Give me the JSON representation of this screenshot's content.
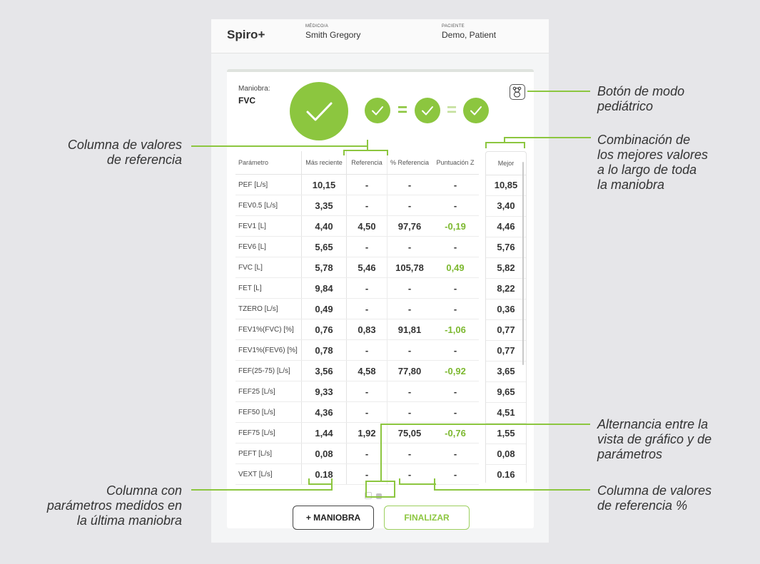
{
  "header": {
    "brand": "Spiro+",
    "doctor_label": "MÉDICO/A",
    "doctor_name": "Smith Gregory",
    "patient_label": "PACIENTE",
    "patient_name": "Demo, Patient"
  },
  "maneuver": {
    "label": "Maniobra:",
    "value": "FVC",
    "eq_sign": "="
  },
  "table": {
    "headers": [
      "Parámetro",
      "Más reciente",
      "Referencia",
      "% Referencia",
      "Puntuación Z"
    ],
    "best_header": "Mejor",
    "rows": [
      {
        "param": "PEF [L/s]",
        "recent": "10,15",
        "ref": "-",
        "pct": "-",
        "z": "-",
        "best": "10,85"
      },
      {
        "param": "FEV0.5 [L/s]",
        "recent": "3,35",
        "ref": "-",
        "pct": "-",
        "z": "-",
        "best": "3,40"
      },
      {
        "param": "FEV1 [L]",
        "recent": "4,40",
        "ref": "4,50",
        "pct": "97,76",
        "z": "-0,19",
        "best": "4,46"
      },
      {
        "param": "FEV6 [L]",
        "recent": "5,65",
        "ref": "-",
        "pct": "-",
        "z": "-",
        "best": "5,76"
      },
      {
        "param": "FVC [L]",
        "recent": "5,78",
        "ref": "5,46",
        "pct": "105,78",
        "z": "0,49",
        "best": "5,82"
      },
      {
        "param": "FET [L]",
        "recent": "9,84",
        "ref": "-",
        "pct": "-",
        "z": "-",
        "best": "8,22"
      },
      {
        "param": "TZERO [L/s]",
        "recent": "0,49",
        "ref": "-",
        "pct": "-",
        "z": "-",
        "best": "0,36"
      },
      {
        "param": "FEV1%(FVC) [%]",
        "recent": "0,76",
        "ref": "0,83",
        "pct": "91,81",
        "z": "-1,06",
        "best": "0,77"
      },
      {
        "param": "FEV1%(FEV6) [%]",
        "recent": "0,78",
        "ref": "-",
        "pct": "-",
        "z": "-",
        "best": "0,77"
      },
      {
        "param": "FEF(25-75) [L/s]",
        "recent": "3,56",
        "ref": "4,58",
        "pct": "77,80",
        "z": "-0,92",
        "best": "3,65"
      },
      {
        "param": "FEF25 [L/s]",
        "recent": "9,33",
        "ref": "-",
        "pct": "-",
        "z": "-",
        "best": "9,65"
      },
      {
        "param": "FEF50 [L/s]",
        "recent": "4,36",
        "ref": "-",
        "pct": "-",
        "z": "-",
        "best": "4,51"
      },
      {
        "param": "FEF75 [L/s]",
        "recent": "1,44",
        "ref": "1,92",
        "pct": "75,05",
        "z": "-0,76",
        "best": "1,55"
      },
      {
        "param": "PEFT [L/s]",
        "recent": "0,08",
        "ref": "-",
        "pct": "-",
        "z": "-",
        "best": "0,08"
      },
      {
        "param": "VEXT [L/s]",
        "recent": "0.18",
        "ref": "-",
        "pct": "-",
        "z": "-",
        "best": "0.16"
      }
    ]
  },
  "buttons": {
    "add_maneuver": "+ MANIOBRA",
    "finish": "FINALIZAR"
  },
  "callouts": {
    "ref_col_1": "Columna de valores",
    "ref_col_2": "de referencia",
    "pedi_1": "Botón de modo",
    "pedi_2": "pediátrico",
    "best_1": "Combinación de",
    "best_2": "los mejores valores",
    "best_3": "a lo largo de toda",
    "best_4": "la maniobra",
    "toggle_1": "Alternancia entre la",
    "toggle_2": "vista de gráfico y de",
    "toggle_3": "parámetros",
    "last_1": "Columna con",
    "last_2": "parámetros medidos en",
    "last_3": "la última maniobra",
    "pct_1": "Columna de valores",
    "pct_2": "de referencia %"
  },
  "colors": {
    "accent": "#8cc63f",
    "background": "#e6e6e9"
  },
  "icons": {
    "pediatric_mode": "teddy-bear-icon",
    "check": "check-icon"
  }
}
